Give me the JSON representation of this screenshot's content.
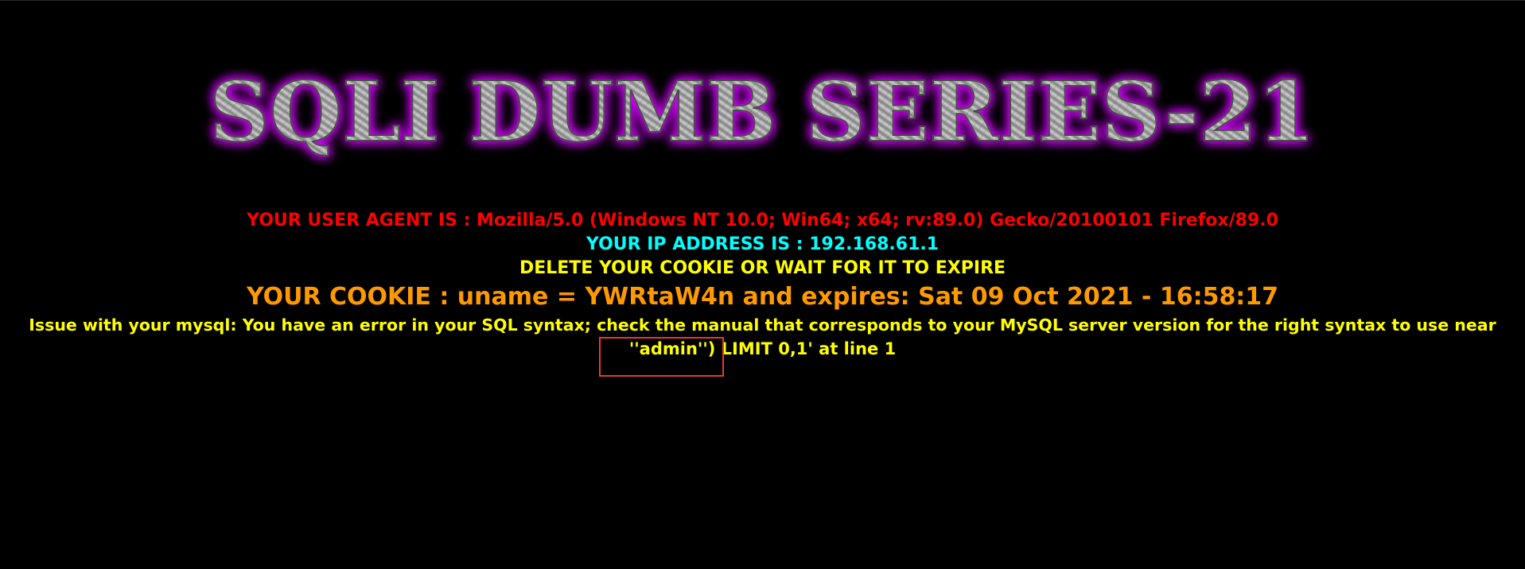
{
  "banner": {
    "title": "SQLI DUMB SERIES-21",
    "glow_color": "#d400ff",
    "text_color": "#a9a9a9"
  },
  "info": {
    "user_agent_line": "YOUR USER AGENT IS : Mozilla/5.0 (Windows NT 10.0; Win64; x64; rv:89.0) Gecko/20100101 Firefox/89.0",
    "ip_line": "YOUR IP ADDRESS IS : 192.168.61.1",
    "delete_cookie_line": "DELETE YOUR COOKIE OR WAIT FOR IT TO EXPIRE",
    "cookie_line": "YOUR COOKIE : uname = YWRtaW4n and expires: Sat 09 Oct 2021 - 16:58:17",
    "error_line_1": "Issue with your mysql: You have an error in your SQL syntax; check the manual that corresponds to your MySQL server version for the right syntax to use near",
    "error_line_2": "''admin'') LIMIT 0,1' at line 1"
  },
  "colors": {
    "background": "#000000",
    "user_agent": "#ff0000",
    "ip": "#00ffff",
    "delete_cookie": "#ffff00",
    "cookie": "#ff9900",
    "error": "#ffff00",
    "highlight_box": "#e53935"
  }
}
